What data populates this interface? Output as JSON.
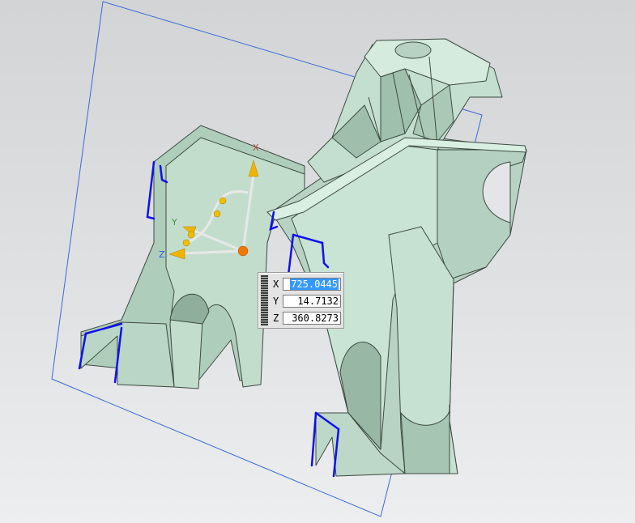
{
  "triad": {
    "x_axis_label": "X",
    "y_axis_label": "Y",
    "z_axis_label": "Z"
  },
  "coordinates": {
    "x_label": "X",
    "x_value": "725.0445",
    "y_label": "Y",
    "y_value": "14.7132",
    "z_label": "Z",
    "z_value": "360.8273"
  },
  "colors": {
    "background_top": "#d2d4d6",
    "background_bottom": "#eceeef",
    "part_face": "#c9e3d4",
    "part_face_dark": "#a9c9b6",
    "selected_edge": "#1010ee",
    "datum_plane": "#3a6ad8",
    "triad_axis": "#f0b400",
    "triad_origin": "#f07800",
    "selection_highlight": "#3399ff"
  }
}
